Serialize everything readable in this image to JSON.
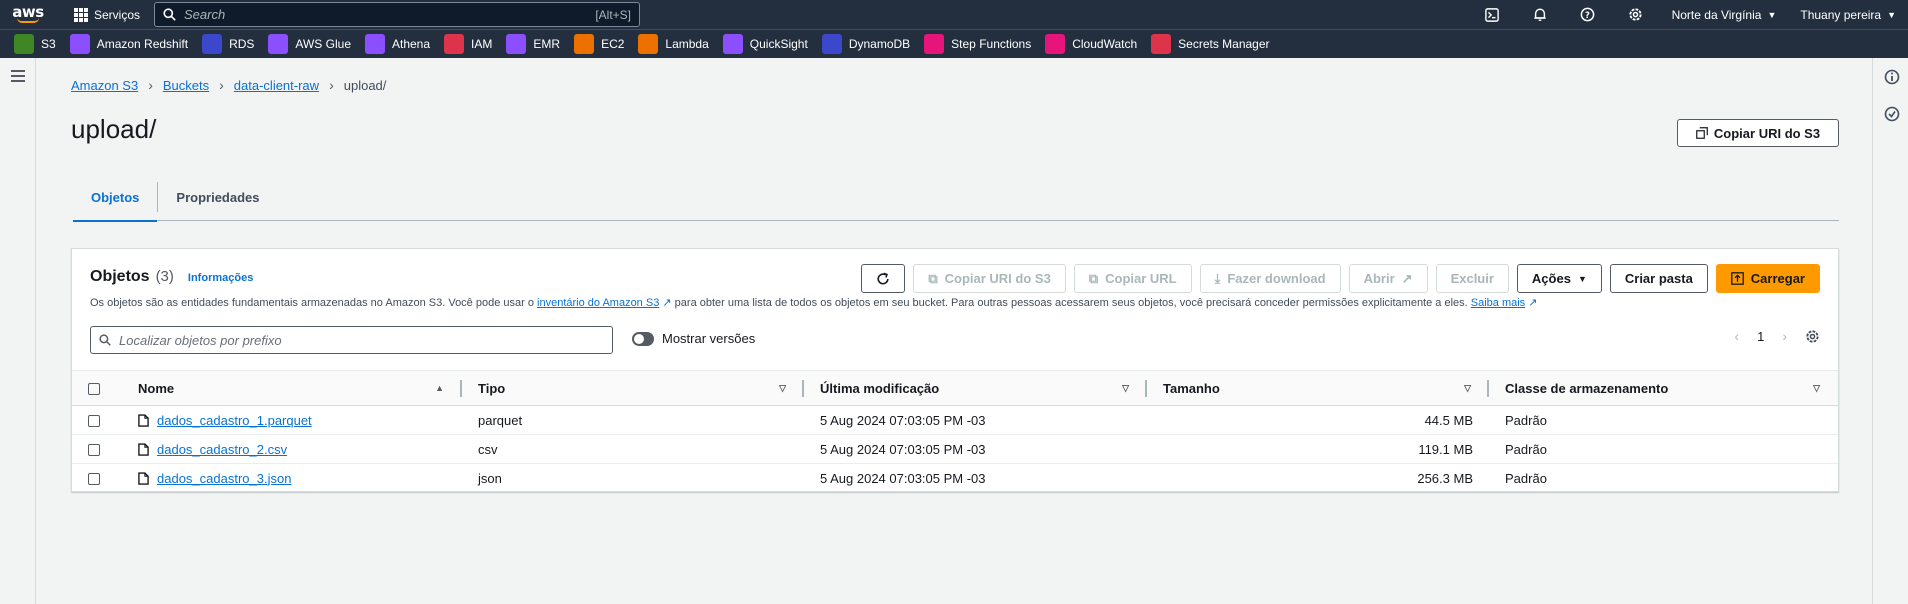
{
  "topbar": {
    "logo": "aws",
    "services_label": "Serviços",
    "search_placeholder": "Search",
    "search_shortcut": "[Alt+S]",
    "region": "Norte da Virgínia",
    "user": "Thuany pereira"
  },
  "favorites": [
    {
      "label": "S3",
      "color": "#3f8624",
      "icon": "s3-icon"
    },
    {
      "label": "Amazon Redshift",
      "color": "#8c4fff",
      "icon": "redshift-icon"
    },
    {
      "label": "RDS",
      "color": "#3b48cc",
      "icon": "rds-icon"
    },
    {
      "label": "AWS Glue",
      "color": "#8c4fff",
      "icon": "glue-icon"
    },
    {
      "label": "Athena",
      "color": "#8c4fff",
      "icon": "athena-icon"
    },
    {
      "label": "IAM",
      "color": "#dd344c",
      "icon": "iam-icon"
    },
    {
      "label": "EMR",
      "color": "#8c4fff",
      "icon": "emr-icon"
    },
    {
      "label": "EC2",
      "color": "#ed7100",
      "icon": "ec2-icon"
    },
    {
      "label": "Lambda",
      "color": "#ed7100",
      "icon": "lambda-icon"
    },
    {
      "label": "QuickSight",
      "color": "#8c4fff",
      "icon": "quicksight-icon"
    },
    {
      "label": "DynamoDB",
      "color": "#3b48cc",
      "icon": "dynamodb-icon"
    },
    {
      "label": "Step Functions",
      "color": "#e7157b",
      "icon": "step-functions-icon"
    },
    {
      "label": "CloudWatch",
      "color": "#e7157b",
      "icon": "cloudwatch-icon"
    },
    {
      "label": "Secrets Manager",
      "color": "#dd344c",
      "icon": "secrets-manager-icon"
    }
  ],
  "breadcrumbs": {
    "items": [
      "Amazon S3",
      "Buckets",
      "data-client-raw"
    ],
    "current": "upload/"
  },
  "page": {
    "title": "upload/",
    "copy_uri_button": "Copiar URI do S3"
  },
  "tabs": [
    "Objetos",
    "Propriedades"
  ],
  "objects_panel": {
    "title": "Objetos",
    "count": "(3)",
    "info_link": "Informações",
    "desc_before": "Os objetos são as entidades fundamentais armazenadas no Amazon S3. Você pode usar o",
    "desc_link": "inventário do Amazon S3",
    "desc_after": "para obter uma lista de todos os objetos em seu bucket. Para outras pessoas acessarem seus objetos, você precisará conceder permissões explicitamente a eles.",
    "learn_more": "Saiba mais",
    "buttons": {
      "copy_uri": "Copiar URI do S3",
      "copy_url": "Copiar URL",
      "download": "Fazer download",
      "open": "Abrir",
      "delete": "Excluir",
      "actions": "Ações",
      "create_folder": "Criar pasta",
      "upload": "Carregar"
    },
    "filter_placeholder": "Localizar objetos por prefixo",
    "show_versions": "Mostrar versões",
    "page_number": "1"
  },
  "table": {
    "columns": [
      "Nome",
      "Tipo",
      "Última modificação",
      "Tamanho",
      "Classe de armazenamento"
    ],
    "rows": [
      {
        "name": "dados_cadastro_1.parquet",
        "type": "parquet",
        "modified": "5 Aug 2024 07:03:05 PM -03",
        "size": "44.5 MB",
        "class": "Padrão"
      },
      {
        "name": "dados_cadastro_2.csv",
        "type": "csv",
        "modified": "5 Aug 2024 07:03:05 PM -03",
        "size": "119.1 MB",
        "class": "Padrão"
      },
      {
        "name": "dados_cadastro_3.json",
        "type": "json",
        "modified": "5 Aug 2024 07:03:05 PM -03",
        "size": "256.3 MB",
        "class": "Padrão"
      }
    ]
  },
  "colors": {
    "nav_bg": "#232f3e",
    "link": "#0972d3",
    "accent": "#ff9900"
  }
}
